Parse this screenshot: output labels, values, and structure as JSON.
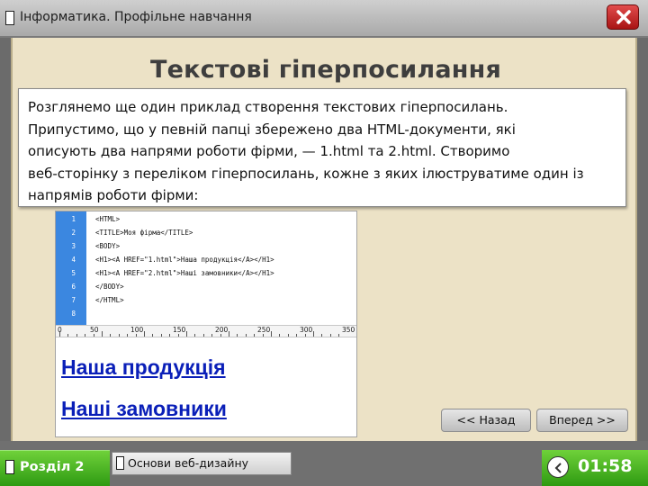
{
  "window": {
    "title": "Інформатика. Профільне навчання",
    "close_icon": "close-x-icon"
  },
  "slide": {
    "title": "Текстові гіперпосилання",
    "paragraph": "Розглянемо ще один приклад створення текстових гіперпосилань.\nПрипустимо, що у певній папці збережено два HTML-документи, які\nописують два напрями роботи фірми, — 1.html та 2.html. Створимо\nвеб-сторінку з переліком гіперпосилань, кожне з яких ілюструватиме один із\nнапрямів роботи фірми:"
  },
  "code_example": {
    "line_numbers": [
      "1",
      "2",
      "3",
      "4",
      "5",
      "6",
      "7",
      "8"
    ],
    "lines": [
      "<HTML>",
      "<TITLE>Моя фірма</TITLE>",
      "<BODY>",
      "<H1><A HREF=\"1.html\">Наша продукція</A></H1>",
      "<H1><A HREF=\"2.html\">Наші замовники</A></H1>",
      "</BODY>",
      "</HTML>",
      ""
    ],
    "ruler_labels": [
      "0",
      "50",
      "100",
      "150",
      "200",
      "250",
      "300",
      "350"
    ]
  },
  "preview": {
    "links": [
      "Наша продукція",
      "Наші замовники"
    ],
    "link_color": "#0a1fb8"
  },
  "navigation": {
    "back_label": "<< Назад",
    "forward_label": "Вперед >>"
  },
  "footer": {
    "section_label": "Розділ 2",
    "module_label": "Основи веб-дизайну",
    "timer": "01:58",
    "timer_icon": "timer-icon"
  },
  "colors": {
    "slide_bg": "#ece2c6",
    "accent_green": "#2e9a12",
    "close_red": "#c02020",
    "gutter_blue": "#3b87e0"
  }
}
